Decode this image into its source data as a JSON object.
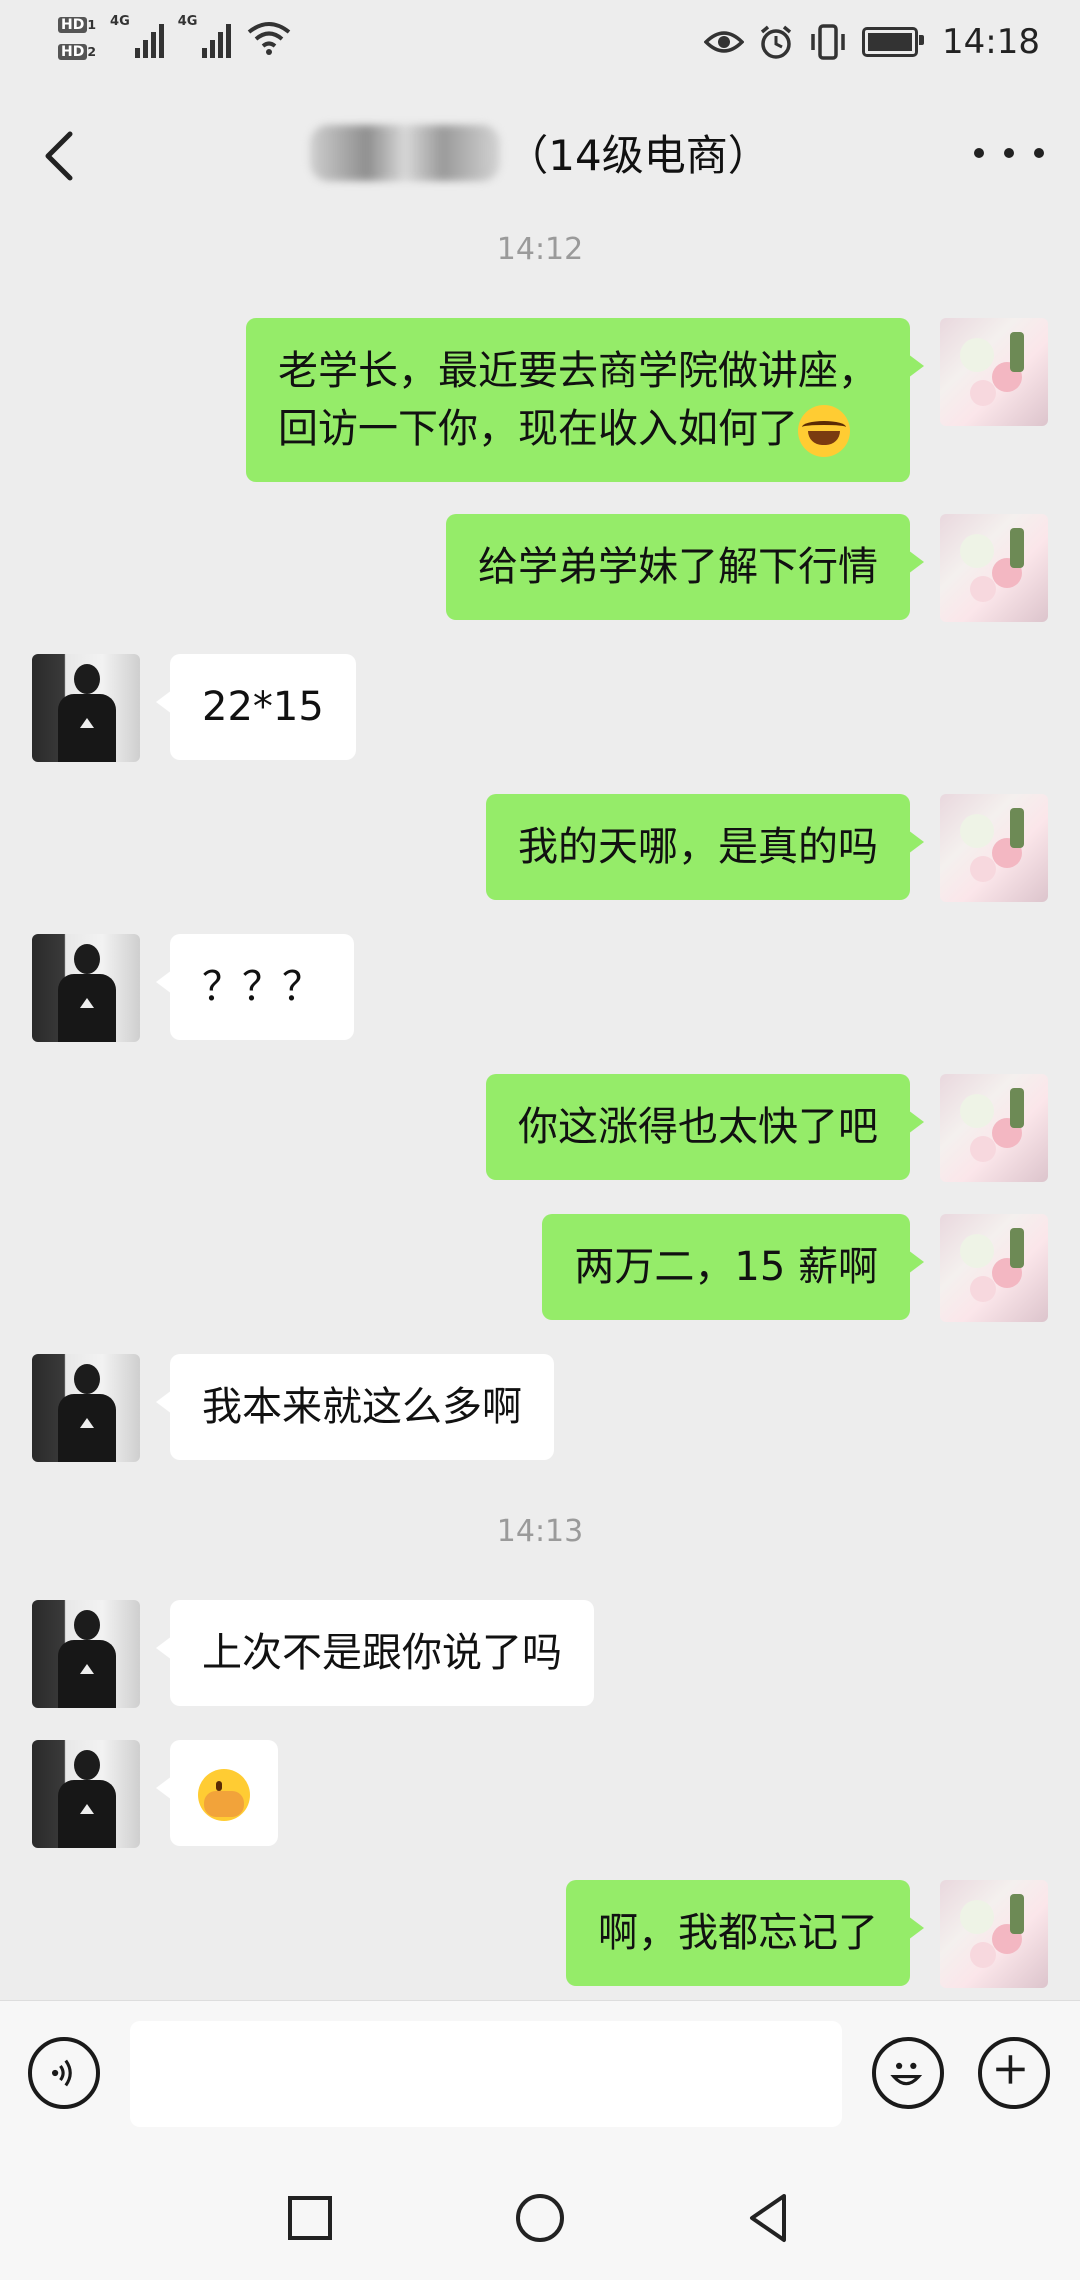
{
  "status_bar": {
    "hd1": "HD",
    "hd1_sub": "1",
    "hd2": "HD",
    "hd2_sub": "2",
    "net1": "4G",
    "net2": "4G",
    "time": "14:18"
  },
  "header": {
    "title": "（14级电商）",
    "contact_name_blurred": true
  },
  "messages": [
    {
      "type": "timestamp",
      "text": "14:12"
    },
    {
      "type": "msg",
      "sender": "me",
      "lines": [
        "老学长，最近要去商学院做讲座，",
        "回访一下你，现在收入如何了"
      ],
      "emoji": "laughing-tears"
    },
    {
      "type": "msg",
      "sender": "me",
      "lines": [
        "给学弟学妹了解下行情"
      ]
    },
    {
      "type": "msg",
      "sender": "other",
      "lines": [
        "22*15"
      ]
    },
    {
      "type": "msg",
      "sender": "me",
      "lines": [
        "我的天哪，是真的吗"
      ]
    },
    {
      "type": "msg",
      "sender": "other",
      "lines": [
        "？？？"
      ]
    },
    {
      "type": "msg",
      "sender": "me",
      "lines": [
        "你这涨得也太快了吧"
      ]
    },
    {
      "type": "msg",
      "sender": "me",
      "lines": [
        "两万二，15 薪啊"
      ]
    },
    {
      "type": "msg",
      "sender": "other",
      "lines": [
        "我本来就这么多啊"
      ]
    },
    {
      "type": "timestamp",
      "text": "14:13"
    },
    {
      "type": "msg",
      "sender": "other",
      "lines": [
        "上次不是跟你说了吗"
      ]
    },
    {
      "type": "msg",
      "sender": "other",
      "lines": [],
      "emoji": "facepalm"
    },
    {
      "type": "msg",
      "sender": "me",
      "lines": [
        "啊，我都忘记了"
      ]
    }
  ],
  "input_bar": {
    "placeholder": "",
    "icons": [
      "voice-icon",
      "emoji-icon",
      "plus-icon"
    ]
  },
  "nav_bar": {
    "icons": [
      "recent-apps-icon",
      "home-icon",
      "back-nav-icon"
    ]
  },
  "colors": {
    "background": "#ededed",
    "my_bubble": "#95ec69",
    "their_bubble": "#ffffff"
  }
}
